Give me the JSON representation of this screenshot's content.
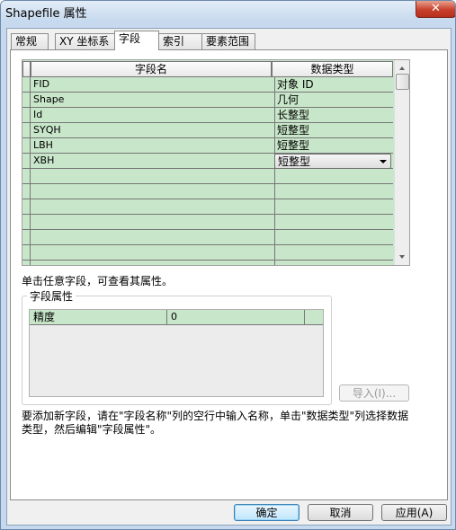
{
  "window": {
    "title": "Shapefile 属性",
    "close_glyph": "✕"
  },
  "tabs": [
    {
      "label": "常规",
      "active": false
    },
    {
      "label": "XY 坐标系",
      "active": false
    },
    {
      "label": "字段",
      "active": true
    },
    {
      "label": "索引",
      "active": false
    },
    {
      "label": "要素范围",
      "active": false
    }
  ],
  "field_table": {
    "headers": [
      "字段名",
      "数据类型"
    ],
    "rows": [
      {
        "name": "FID",
        "type": "对象 ID"
      },
      {
        "name": "Shape",
        "type": "几何"
      },
      {
        "name": "Id",
        "type": "长整型"
      },
      {
        "name": "SYQH",
        "type": "短整型"
      },
      {
        "name": "LBH",
        "type": "短整型"
      },
      {
        "name": "XBH",
        "type": "短整型"
      }
    ],
    "selected_row_combo": "短整型",
    "empty_rows": 7
  },
  "hint_click": "单击任意字段，可查看其属性。",
  "field_properties": {
    "group_label": "字段属性",
    "rows": [
      {
        "name": "精度",
        "value": "0"
      }
    ]
  },
  "import_button": "导入(I)...",
  "hint_add": "要添加新字段，请在\"字段名称\"列的空行中输入名称，单击\"数据类型\"列选择数据类型，然后编辑\"字段属性\"。",
  "buttons": {
    "ok": "确定",
    "cancel": "取消",
    "apply": "应用(A)"
  }
}
